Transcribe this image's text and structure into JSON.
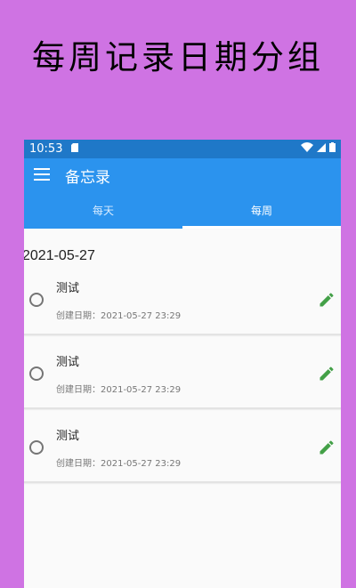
{
  "banner": {
    "title": "每周记录日期分组"
  },
  "status_bar": {
    "time": "10:53"
  },
  "app_bar": {
    "title": "备忘录"
  },
  "tabs": [
    {
      "label": "每天",
      "active": false
    },
    {
      "label": "每周",
      "active": true
    }
  ],
  "group": {
    "date": "2021-05-27"
  },
  "items": [
    {
      "title": "测试",
      "subtitle": "创建日期：2021-05-27 23:29"
    },
    {
      "title": "测试",
      "subtitle": "创建日期：2021-05-27 23:29"
    },
    {
      "title": "测试",
      "subtitle": "创建日期：2021-05-27 23:29"
    }
  ],
  "colors": {
    "background": "#cf73e3",
    "app_bar": "#2b93ee",
    "status_bar": "#1f78c8",
    "edit_icon": "#43a047"
  }
}
